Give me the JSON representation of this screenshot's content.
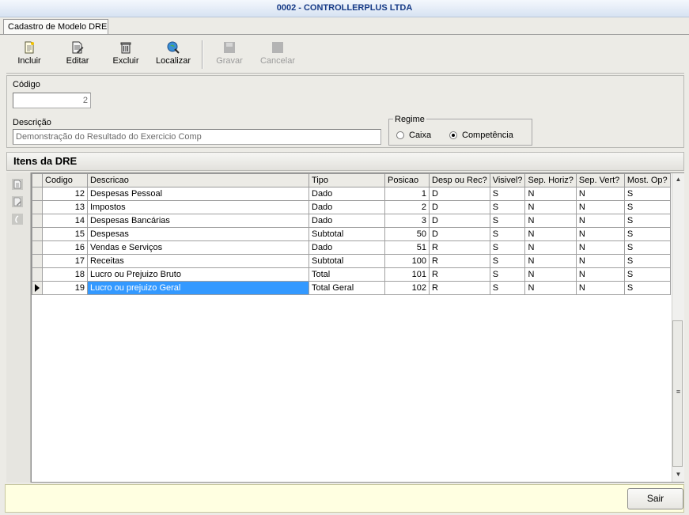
{
  "window": {
    "title": "0002 - CONTROLLERPLUS LTDA"
  },
  "tab": {
    "label": "Cadastro de Modelo DRE"
  },
  "toolbar": {
    "incluir": "Incluir",
    "editar": "Editar",
    "excluir": "Excluir",
    "localizar": "Localizar",
    "gravar": "Gravar",
    "cancelar": "Cancelar"
  },
  "form": {
    "codigo_label": "Código",
    "codigo_value": "2",
    "descricao_label": "Descrição",
    "descricao_value": "Demonstração do Resultado do Exercicio Comp",
    "regime_label": "Regime",
    "regime_caixa": "Caixa",
    "regime_competencia": "Competência",
    "regime_selected": "Competência"
  },
  "section": {
    "title": "Itens da DRE"
  },
  "grid": {
    "columns": [
      "Codigo",
      "Descricao",
      "Tipo",
      "Posicao",
      "Desp ou Rec?",
      "Visivel?",
      "Sep. Horiz?",
      "Sep. Vert?",
      "Most. Op?"
    ],
    "rows": [
      [
        "12",
        "Despesas Pessoal",
        "Dado",
        "1",
        "D",
        "S",
        "N",
        "N",
        "S"
      ],
      [
        "13",
        "Impostos",
        "Dado",
        "2",
        "D",
        "S",
        "N",
        "N",
        "S"
      ],
      [
        "14",
        "Despesas Bancárias",
        "Dado",
        "3",
        "D",
        "S",
        "N",
        "N",
        "S"
      ],
      [
        "15",
        "Despesas",
        "Subtotal",
        "50",
        "D",
        "S",
        "N",
        "N",
        "S"
      ],
      [
        "16",
        "Vendas e Serviços",
        "Dado",
        "51",
        "R",
        "S",
        "N",
        "N",
        "S"
      ],
      [
        "17",
        "Receitas",
        "Subtotal",
        "100",
        "R",
        "S",
        "N",
        "N",
        "S"
      ],
      [
        "18",
        "Lucro ou Prejuizo Bruto",
        "Total",
        "101",
        "R",
        "S",
        "N",
        "N",
        "S"
      ],
      [
        "19",
        "Lucro ou prejuizo Geral",
        "Total Geral",
        "102",
        "R",
        "S",
        "N",
        "N",
        "S"
      ]
    ],
    "selected_row": 7
  },
  "footer": {
    "sair": "Sair"
  },
  "colors": {
    "title_text": "#163a86",
    "selection": "#3399ff",
    "footer_bg": "#ffffe1"
  },
  "icons": [
    "new-doc-icon",
    "edit-doc-icon",
    "trash-icon",
    "globe-search-icon",
    "save-icon",
    "cancel-icon"
  ]
}
